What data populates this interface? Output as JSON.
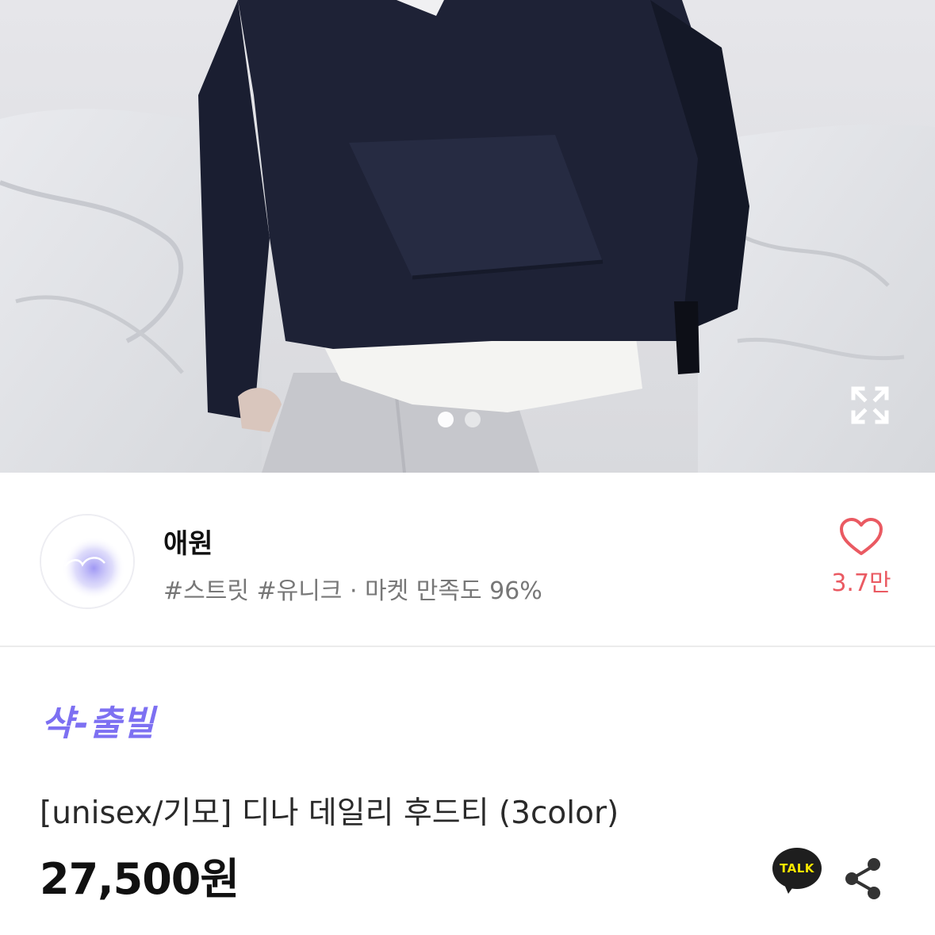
{
  "gallery": {
    "slide_count": 2,
    "active_slide": 1,
    "expand_icon": "expand-icon"
  },
  "store": {
    "name": "애원",
    "tags": "#스트릿 #유니크 · 마켓 만족도 96%",
    "avatar_icon": "store-logo",
    "like_icon": "heart-outline-icon",
    "like_count": "3.7만"
  },
  "product": {
    "promo_badge": "샥-출빌",
    "title": "[unisex/기모] 디나 데일리 후드티 (3color)",
    "price": "27,500원",
    "talk_label": "TALK",
    "share_icon": "share-icon"
  },
  "colors": {
    "promo": "#7d70f2",
    "like": "#ea5a62",
    "talk_bg": "#1e1e1e",
    "talk_text": "#f7e600"
  }
}
